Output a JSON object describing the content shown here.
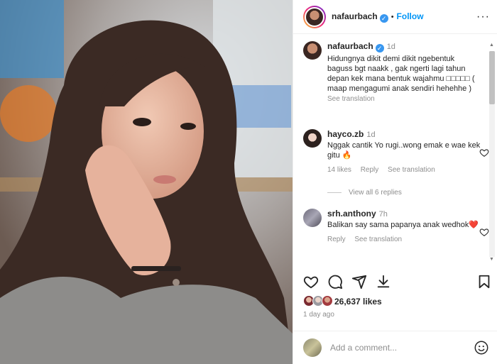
{
  "header": {
    "username": "nafaurbach",
    "verified_mark": "✓",
    "separator": "•",
    "follow_label": "Follow",
    "more_label": "···"
  },
  "comments": [
    {
      "username": "nafaurbach",
      "verified_mark": "✓",
      "time": "1d",
      "text": "Hidungnya dikit demi dikit ngebentuk baguss bgt naakk , gak ngerti lagi tahun depan kek mana bentuk wajahmu □□□□□ ( maap mengagumi anak sendiri hehehhe )",
      "see_translation": "See translation"
    },
    {
      "username": "hayco.zb",
      "time": "1d",
      "text": "Nggak cantik Yo rugi..wong emak e wae kek gitu 🔥",
      "likes": "14 likes",
      "reply": "Reply",
      "see_translation": "See translation"
    },
    {
      "username": "srh.anthony",
      "time": "7h",
      "text": "Balikan say sama papanya anak wedhok❤️",
      "reply": "Reply",
      "see_translation": "See translation"
    }
  ],
  "view_replies": "View all 6 replies",
  "likes": {
    "count": "26,637 likes"
  },
  "posted": "1 day ago",
  "add_comment": {
    "placeholder": "Add a comment..."
  },
  "icons": {
    "like": "heart-icon",
    "comment": "comment-icon",
    "share": "share-icon",
    "save": "bookmark-icon",
    "emoji": "emoji-icon"
  },
  "colors": {
    "accent": "#0095f6",
    "verified": "#3897f0",
    "like_heart": "#ed4956"
  }
}
